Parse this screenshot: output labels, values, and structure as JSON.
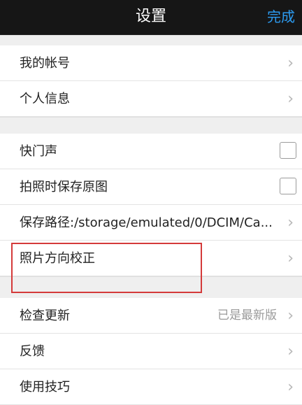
{
  "header": {
    "title": "设置",
    "done_label": "完成"
  },
  "rows": [
    {
      "label": "我的帐号",
      "chevron": "›"
    },
    {
      "label": "个人信息",
      "chevron": "›"
    },
    {
      "label": "快门声",
      "checked": false
    },
    {
      "label": "拍照时保存原图",
      "checked": false
    },
    {
      "label": "保存路径:/storage/emulated/0/DCIM/Ca...",
      "chevron": "›"
    },
    {
      "label": "照片方向校正",
      "chevron": "›"
    },
    {
      "label": "检查更新",
      "value": "已是最新版",
      "chevron": "›"
    },
    {
      "label": "反馈",
      "chevron": "›"
    },
    {
      "label": "使用技巧",
      "chevron": "›"
    }
  ],
  "colors": {
    "accent": "#2c9bf0",
    "highlight_border": "#d43a3a",
    "header_bg": "#161616"
  }
}
